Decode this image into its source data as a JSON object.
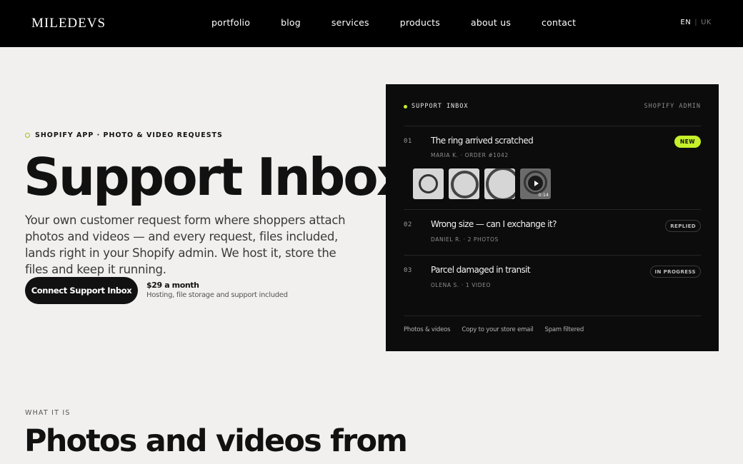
{
  "nav": {
    "logo": "MILEDEVS",
    "links": [
      "portfolio",
      "blog",
      "services",
      "products",
      "about us",
      "contact"
    ],
    "lang_active": "EN",
    "lang_separator": "|",
    "lang_other": "UK"
  },
  "hero": {
    "eyebrow": "SHOPIFY APP · PHOTO & VIDEO REQUESTS",
    "title": "Support Inbox",
    "description": "Your own customer request form where shoppers attach photos and videos — and every request, files included, lands right in your Shopify admin. We host it, store the files and keep it running.",
    "cta_label": "Connect Support Inbox",
    "price": "$29 a month",
    "price_sub": "Hosting, file storage and support included"
  },
  "panel": {
    "title": "SUPPORT INBOX",
    "subtitle": "SHOPIFY ADMIN",
    "rows": [
      {
        "num": "01",
        "title": "The ring arrived scratched",
        "meta": "MARIA K. · ORDER #1042",
        "badge": "NEW"
      },
      {
        "num": "02",
        "title": "Wrong size — can I exchange it?",
        "meta": "DANIEL R. · 2 PHOTOS",
        "badge": "REPLIED"
      },
      {
        "num": "03",
        "title": "Parcel damaged in transit",
        "meta": "OLENA S. · 1 VIDEO",
        "badge": "IN PROGRESS"
      }
    ],
    "video_duration": "0:14",
    "footer": [
      "Photos & videos",
      "Copy to your store email",
      "Spam filtered"
    ],
    "accent": "#c5f02a"
  },
  "what": {
    "eyebrow": "WHAT IT IS",
    "title": "Photos and videos from"
  }
}
